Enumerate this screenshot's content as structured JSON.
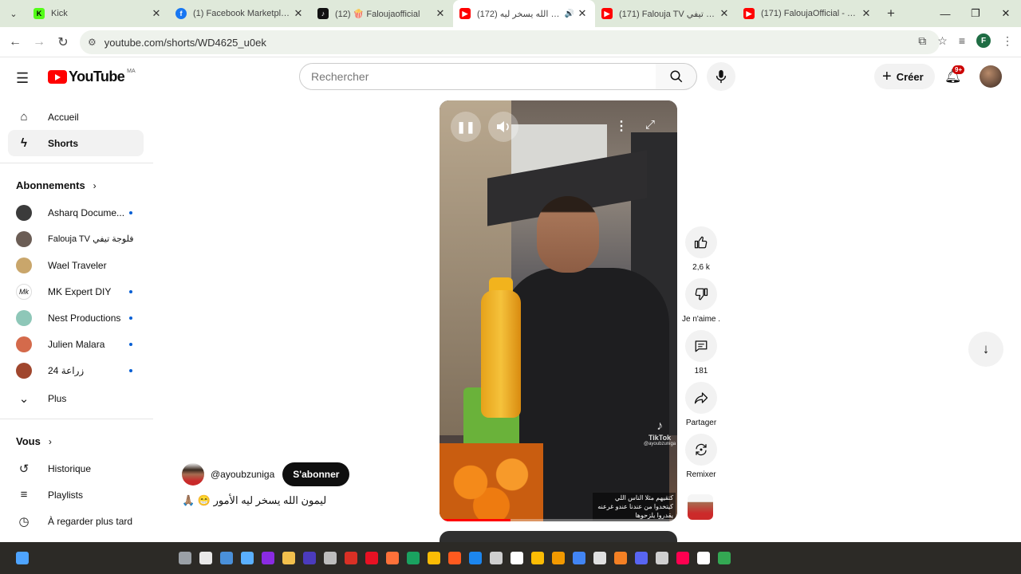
{
  "browser": {
    "tabs": [
      {
        "title": "Kick",
        "color": "#53fc18",
        "active": false
      },
      {
        "title": "(1) Facebook Marketplace",
        "color": "#1877f2",
        "active": false
      },
      {
        "title": "(12) 🍿 Faloujaofficial",
        "color": "#111111",
        "active": false
      },
      {
        "title": "(172) ليمون الله يسخر ليه",
        "color": "#ff0000",
        "active": true
      },
      {
        "title": "(171) Falouja TV فلوجة تيفي",
        "color": "#ff0000",
        "active": false
      },
      {
        "title": "(171) FaloujaOfficial - YouT",
        "color": "#ff0000",
        "active": false
      }
    ],
    "url": "youtube.com/shorts/WD4625_u0ek",
    "profile_letter": "F"
  },
  "header": {
    "logo_text": "YouTube",
    "country_code": "MA",
    "search_placeholder": "Rechercher",
    "create_label": "Créer",
    "notification_count": "9+"
  },
  "sidebar": {
    "main": [
      {
        "label": "Accueil",
        "icon": "home-icon",
        "active": false
      },
      {
        "label": "Shorts",
        "icon": "shorts-icon",
        "active": true
      }
    ],
    "subscriptions_title": "Abonnements",
    "subscriptions": [
      {
        "label": "Asharq Docume...",
        "color": "#3b3b3b",
        "new": true
      },
      {
        "label": "Falouja TV فلوجة تيفي",
        "color": "#6b5d55",
        "new": false
      },
      {
        "label": "Wael Traveler",
        "color": "#c9a66b",
        "new": false
      },
      {
        "label": "MK Expert DIY",
        "color": "#ffffff",
        "new": true
      },
      {
        "label": "Nest Productions",
        "color": "#8ec7b8",
        "new": true
      },
      {
        "label": "Julien Malara",
        "color": "#d46a4b",
        "new": true
      },
      {
        "label": "زراعة 24",
        "color": "#a0462d",
        "new": true
      }
    ],
    "more_label": "Plus",
    "you_title": "Vous",
    "you_items": [
      {
        "label": "Historique",
        "icon": "history-icon"
      },
      {
        "label": "Playlists",
        "icon": "playlist-icon"
      },
      {
        "label": "À regarder plus tard",
        "icon": "watch-later-icon"
      }
    ]
  },
  "short": {
    "overlay_text": "كتقيهم مثلا الناس اللي كيتخدوا من عندنا عندو غرعنه يقدروا يلزحوها",
    "watermark": "TikTok",
    "watermark_handle": "@ayoubzuniga",
    "progress": 0.3,
    "creator_handle": "@ayoubzuniga",
    "subscribe_label": "S'abonner",
    "title": "ليمون الله يسخر ليه الأمور 😁 🙏🏽"
  },
  "actions": {
    "likes": "2,6 k",
    "dislike_label": "Je n'aime .",
    "comments": "181",
    "share_label": "Partager",
    "remix_label": "Remixer"
  },
  "taskbar": {
    "icons": [
      "#4ea4ff",
      "#9aa0a6",
      "#e8e8e8",
      "#4a90d9",
      "#5ab0ff",
      "#8a2be2",
      "#f2c04d",
      "#4b3bbd",
      "#bdbdbd",
      "#d93025",
      "#e81123",
      "#ff7139",
      "#1aa260",
      "#fbbc05",
      "#ff5a1f",
      "#1c86ee",
      "#cfcfcf",
      "#ffffff",
      "#fbbc05",
      "#f29900",
      "#4285f4",
      "#e0e0e0",
      "#f48024",
      "#5865f2",
      "#cfcfcf",
      "#ff0050",
      "#ffffff",
      "#34a853"
    ]
  }
}
